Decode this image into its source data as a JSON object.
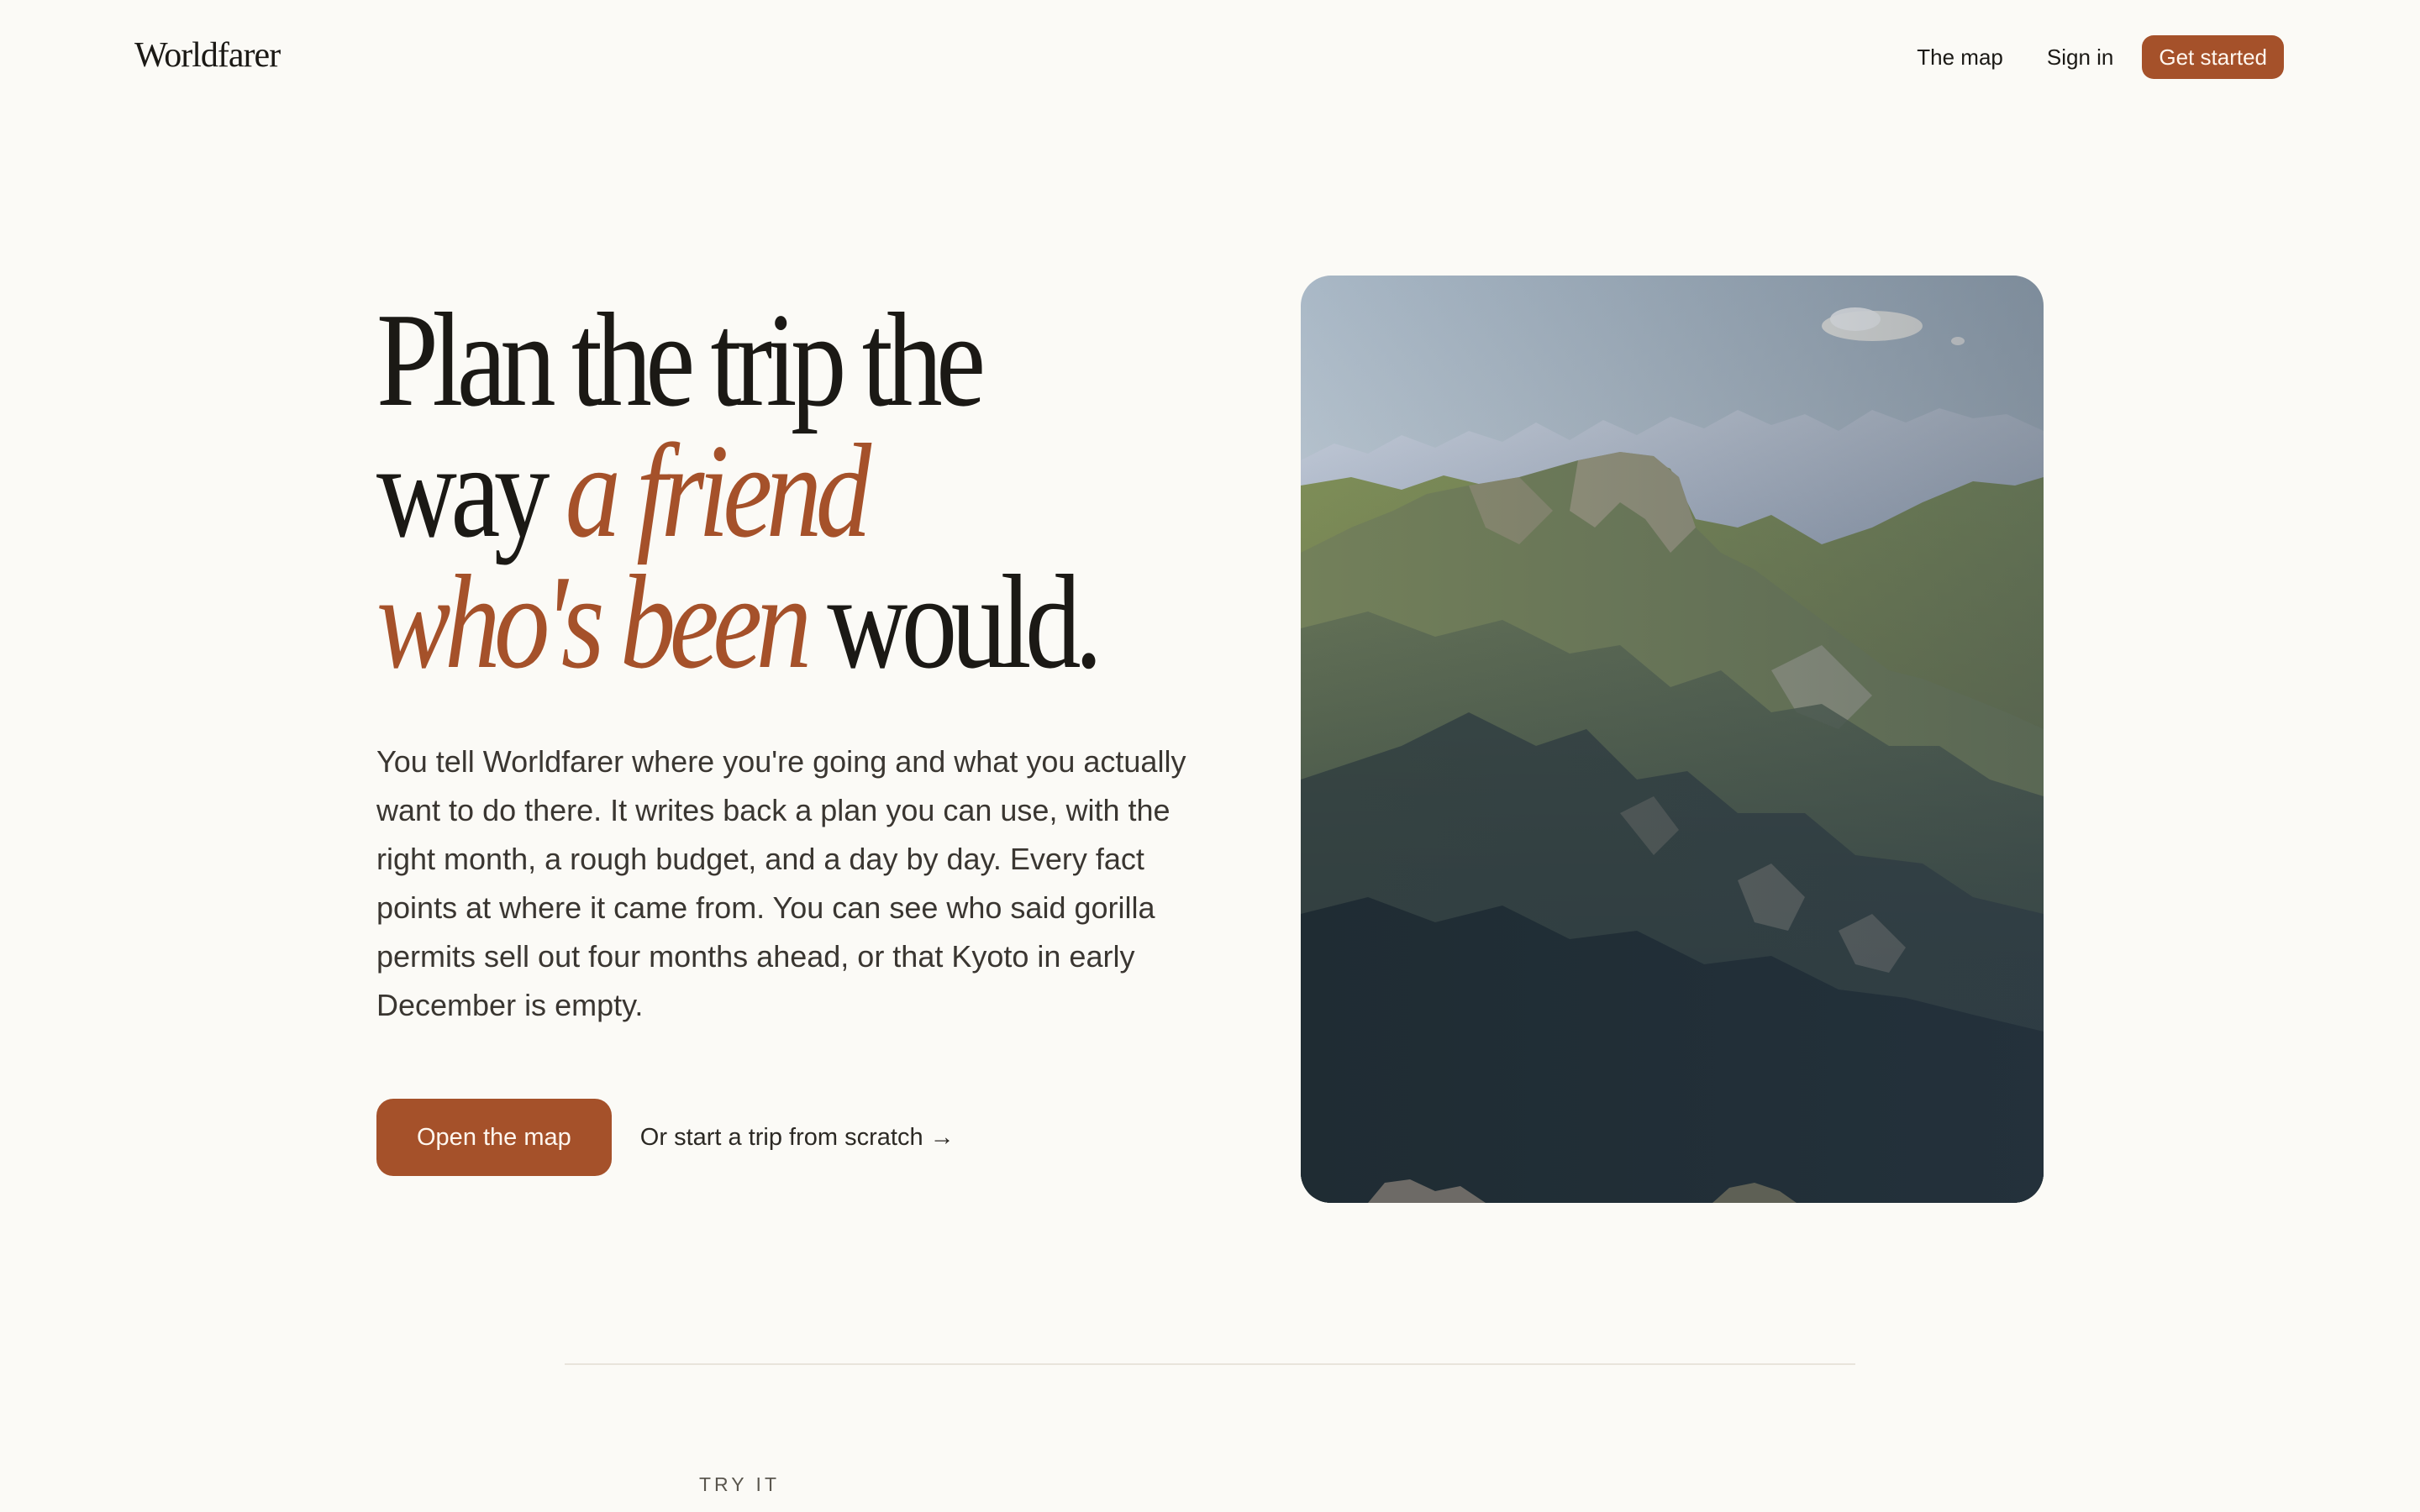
{
  "brand": {
    "name": "Worldfarer"
  },
  "nav": {
    "links": [
      {
        "label": "The map"
      },
      {
        "label": "Sign in"
      }
    ],
    "cta_label": "Get started"
  },
  "hero": {
    "headline": {
      "line1": "Plan the trip the",
      "line2_plain": "way ",
      "line2_accent": "a friend",
      "line3_accent": "who's been",
      "line3_plain": " would."
    },
    "lede": "You tell Worldfarer where you're going and what you actually want to do there. It writes back a plan you can use, with the right month, a rough budget, and a day by day. Every fact points at where it came from. You can see who said gorilla permits sell out four months ahead, or that Kyoto in early December is empty.",
    "primary_button": "Open the map",
    "secondary_link": "Or start a trip from scratch →",
    "image_subject": "mountain-landscape"
  },
  "section": {
    "eyebrow": "TRY IT"
  },
  "colors": {
    "background": "#fbfaf6",
    "accent": "#a5512a",
    "text": "#1b1915"
  }
}
